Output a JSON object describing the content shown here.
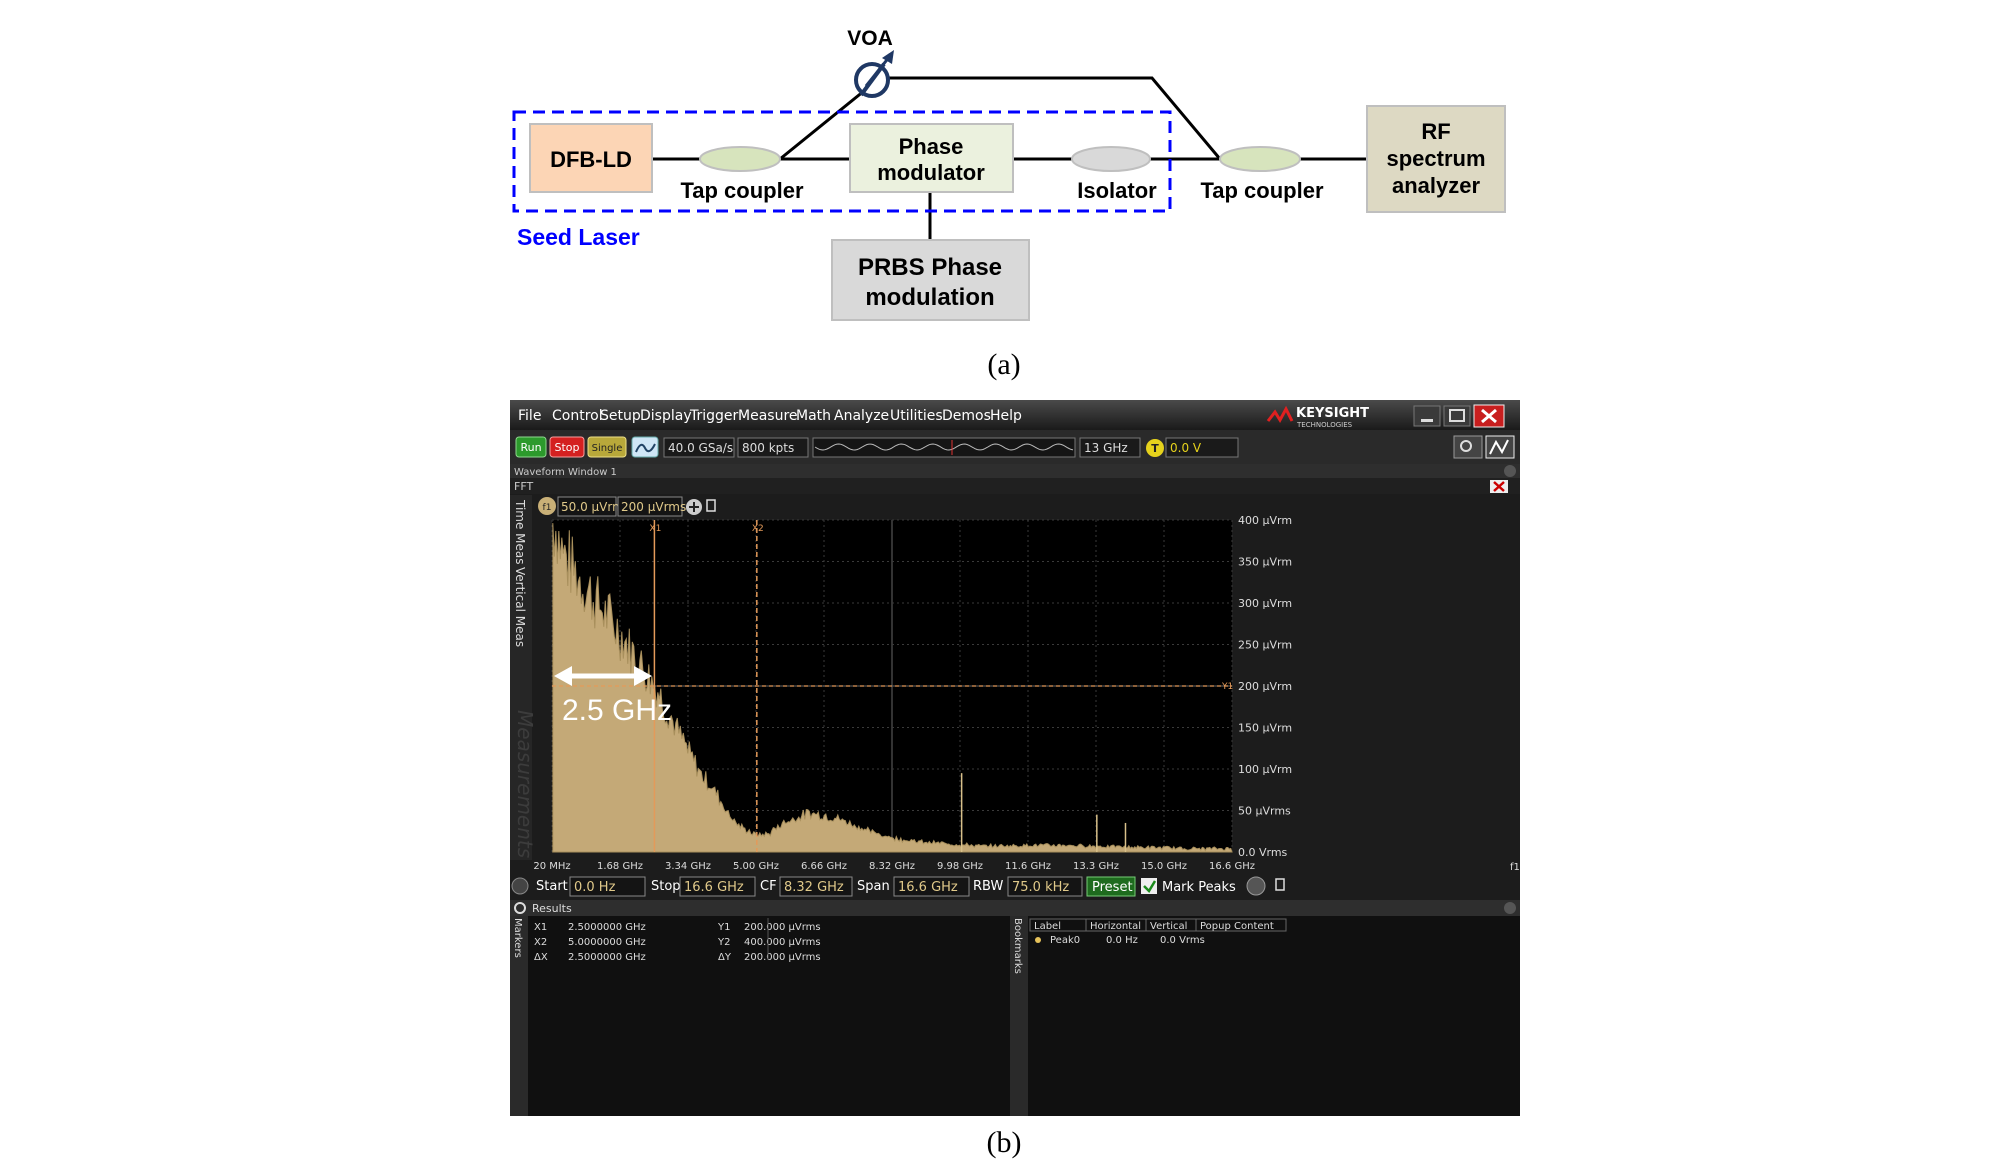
{
  "diagram": {
    "voa": "VOA",
    "dfb": "DFB-LD",
    "tap1": "Tap coupler",
    "pm_l1": "Phase",
    "pm_l2": "modulator",
    "isolator": "Isolator",
    "tap2": "Tap coupler",
    "rf_l1": "RF",
    "rf_l2": "spectrum",
    "rf_l3": "analyzer",
    "prbs_l1": "PRBS Phase",
    "prbs_l2": "modulation",
    "seed": "Seed Laser",
    "caption_a": "(a)"
  },
  "colors": {
    "dfb_fill": "#fcd5b5",
    "pm_fill": "#ebf1de",
    "coupler_fill": "#d7e4bd",
    "isolator_fill": "#d9d9d9",
    "rf_fill": "#ddd9c3",
    "prbs_fill": "#d9d9d9",
    "seed_border": "#0000ff",
    "spectrum_fill": "#c4a977",
    "marker_orange": "#e39a5a"
  },
  "scope": {
    "menu": [
      "File",
      "Control",
      "Setup",
      "Display",
      "Trigger",
      "Measure",
      "Math",
      "Analyze",
      "Utilities",
      "Demos",
      "Help"
    ],
    "brand": "KEYSIGHT",
    "brand_sub": "TECHNOLOGIES",
    "run": "Run",
    "stop": "Stop",
    "single": "Single",
    "sample_rate": "40.0 GSa/s",
    "points": "800 kpts",
    "bandwidth": "13 GHz",
    "trigger_badge": "T",
    "trigger_level": "0.0 V",
    "waveform_window": "Waveform Window 1",
    "fft": "FFT",
    "side_time": "Time Meas",
    "side_vertical": "Vertical Meas",
    "watermark": "Measurements",
    "scale_badge": "f1",
    "scale": "50.0 μVrm",
    "offset": "200 μVrms",
    "marker_x1": "X1",
    "marker_x2": "X2",
    "marker_y1": "Y1",
    "annot": "2.5 GHz",
    "y_ticks": [
      "400 μVrm",
      "350 μVrm",
      "300 μVrm",
      "250 μVrm",
      "200 μVrm",
      "150 μVrm",
      "100 μVrm",
      "50 μVrms",
      "0.0 Vrms"
    ],
    "x_ticks": [
      "20 MHz",
      "1.68 GHz",
      "3.34 GHz",
      "5.00 GHz",
      "6.66 GHz",
      "8.32 GHz",
      "9.98 GHz",
      "11.6 GHz",
      "13.3 GHz",
      "15.0 GHz",
      "16.6 GHz"
    ],
    "x_unit": "f1",
    "start_label": "Start",
    "start_val": "0.0 Hz",
    "stop_label": "Stop",
    "stop_val": "16.6 GHz",
    "cf_label": "CF",
    "cf_val": "8.32 GHz",
    "span_label": "Span",
    "span_val": "16.6 GHz",
    "rbw_label": "RBW",
    "rbw_val": "75.0 kHz",
    "preset": "Preset",
    "mark_peaks": "Mark Peaks",
    "results": "Results",
    "markers_tab": "Markers",
    "bookmarks_tab": "Bookmarks",
    "res": [
      {
        "k": "X1",
        "v": "2.5000000 GHz",
        "k2": "Y1",
        "v2": "200.000 μVrms"
      },
      {
        "k": "X2",
        "v": "5.0000000 GHz",
        "k2": "Y2",
        "v2": "400.000 μVrms"
      },
      {
        "k": "ΔX",
        "v": "2.5000000 GHz",
        "k2": "ΔY",
        "v2": "200.000 μVrms"
      }
    ],
    "bm_headers": [
      "Label",
      "Horizontal",
      "Vertical",
      "Popup Content"
    ],
    "bm_row": [
      "Peak0",
      "0.0 Hz",
      "0.0 Vrms"
    ],
    "caption_b": "(b)"
  },
  "chart_data": {
    "type": "area",
    "title": "",
    "x_unit": "GHz",
    "y_unit": "μVrms",
    "xlim": [
      0.02,
      16.6
    ],
    "ylim": [
      0,
      400
    ],
    "x": [
      0.02,
      0.1,
      0.2,
      0.3,
      0.5,
      0.7,
      1.0,
      1.3,
      1.68,
      2.0,
      2.3,
      2.5,
      2.8,
      3.1,
      3.34,
      3.6,
      4.0,
      4.3,
      4.6,
      5.0,
      5.3,
      5.6,
      6.0,
      6.3,
      6.66,
      7.0,
      7.4,
      7.8,
      8.32,
      9.0,
      9.98,
      10.5,
      11.6,
      12.3,
      13.3,
      14.0,
      15.0,
      15.5,
      16.6
    ],
    "values": [
      395,
      390,
      370,
      355,
      340,
      325,
      305,
      285,
      260,
      235,
      215,
      200,
      170,
      140,
      118,
      95,
      70,
      45,
      28,
      18,
      20,
      32,
      40,
      45,
      42,
      38,
      30,
      22,
      15,
      10,
      7,
      5,
      6,
      6,
      5,
      4,
      3,
      2,
      2
    ],
    "spurs": [
      {
        "x": 10.0,
        "y": 95
      },
      {
        "x": 13.3,
        "y": 45
      },
      {
        "x": 14.0,
        "y": 35
      }
    ],
    "markers": {
      "x1": 2.5,
      "x2": 5.0,
      "y1": 200,
      "y2": 400
    },
    "grid": true
  }
}
